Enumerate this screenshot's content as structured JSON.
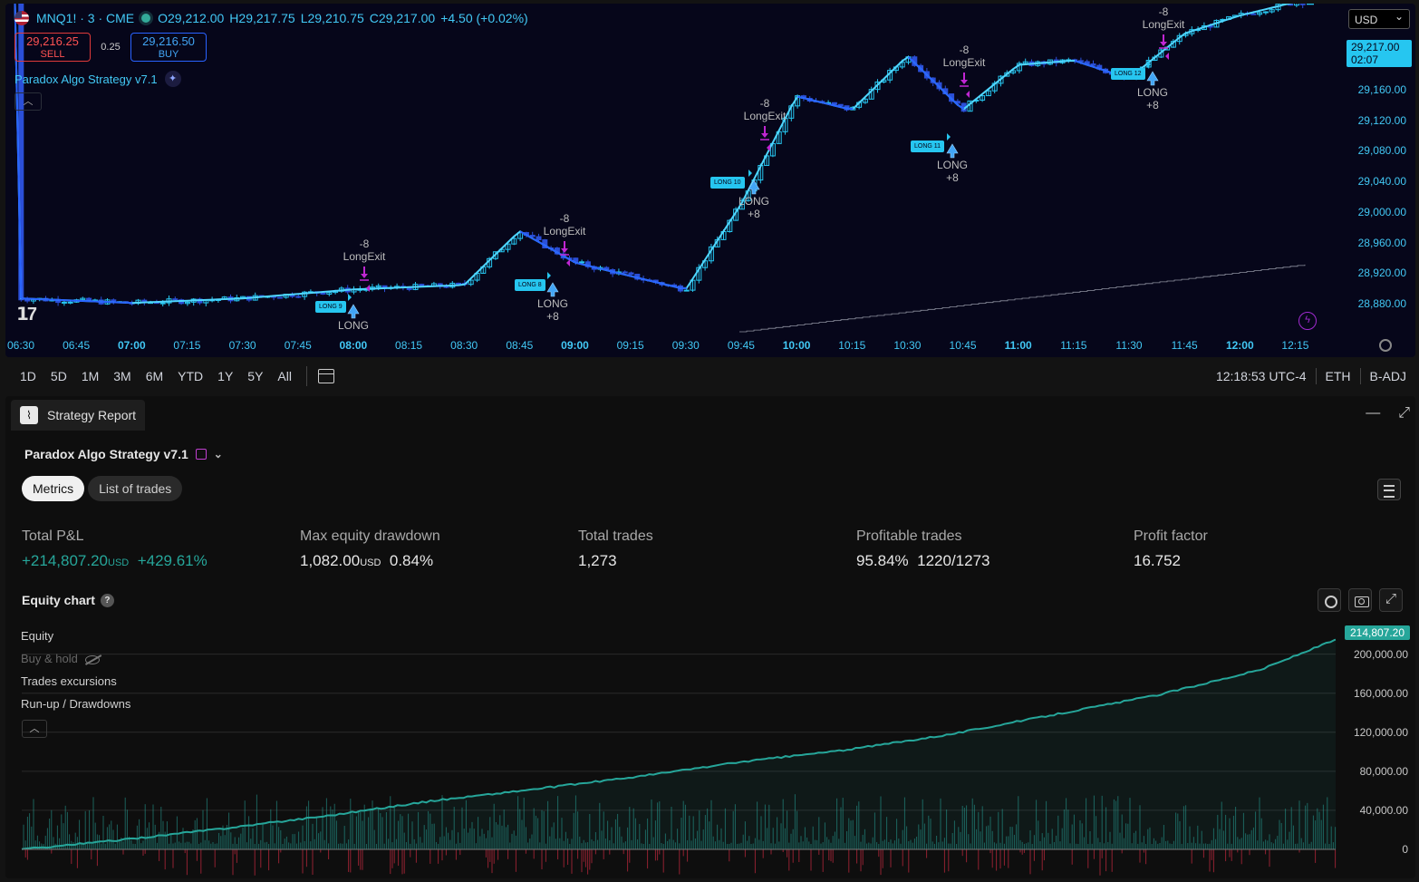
{
  "symbol": {
    "name": "MNQ1! · 3 · CME",
    "open": "O29,212.00",
    "high": "H29,217.75",
    "low": "L29,210.75",
    "close": "C29,217.00",
    "change": "+4.50 (+0.02%)"
  },
  "trade": {
    "sell_price": "29,216.25",
    "sell_label": "SELL",
    "spread": "0.25",
    "buy_price": "29,216.50",
    "buy_label": "BUY"
  },
  "strategy_indicator": "Paradox Algo Strategy v7.1",
  "currency": "USD",
  "last_price": "29,217.00",
  "countdown": "02:07",
  "price_axis": [
    "29,160.00",
    "29,120.00",
    "29,080.00",
    "29,040.00",
    "29,000.00",
    "28,960.00",
    "28,920.00",
    "28,880.00"
  ],
  "time_axis": [
    {
      "t": "06:30",
      "b": false
    },
    {
      "t": "06:45",
      "b": false
    },
    {
      "t": "07:00",
      "b": true
    },
    {
      "t": "07:15",
      "b": false
    },
    {
      "t": "07:30",
      "b": false
    },
    {
      "t": "07:45",
      "b": false
    },
    {
      "t": "08:00",
      "b": true
    },
    {
      "t": "08:15",
      "b": false
    },
    {
      "t": "08:30",
      "b": false
    },
    {
      "t": "08:45",
      "b": false
    },
    {
      "t": "09:00",
      "b": true
    },
    {
      "t": "09:15",
      "b": false
    },
    {
      "t": "09:30",
      "b": false
    },
    {
      "t": "09:45",
      "b": false
    },
    {
      "t": "10:00",
      "b": true
    },
    {
      "t": "10:15",
      "b": false
    },
    {
      "t": "10:30",
      "b": false
    },
    {
      "t": "10:45",
      "b": false
    },
    {
      "t": "11:00",
      "b": true
    },
    {
      "t": "11:15",
      "b": false
    },
    {
      "t": "11:30",
      "b": false
    },
    {
      "t": "11:45",
      "b": false
    },
    {
      "t": "12:00",
      "b": true
    },
    {
      "t": "12:15",
      "b": false
    }
  ],
  "markers": {
    "exit_qty": "-8",
    "exit_label": "LongExit",
    "long_label": "LONG",
    "long_qty": "+8",
    "pill_texts": [
      "LONG 9",
      "LONG 8",
      "LONG 10",
      "LONG 11",
      "LONG 12"
    ]
  },
  "ranges": [
    "1D",
    "5D",
    "1M",
    "3M",
    "6M",
    "YTD",
    "1Y",
    "5Y",
    "All"
  ],
  "status": {
    "clock": "12:18:53 UTC-4",
    "session": "ETH",
    "adj": "B-ADJ"
  },
  "report": {
    "tab_label": "Strategy Report",
    "title": "Paradox Algo Strategy v7.1",
    "tabs": [
      "Metrics",
      "List of trades"
    ],
    "metrics": {
      "pnl_label": "Total P&L",
      "pnl_value": "+214,807.20",
      "pnl_unit": "USD",
      "pnl_pct": "+429.61%",
      "dd_label": "Max equity drawdown",
      "dd_value": "1,082.00",
      "dd_unit": "USD",
      "dd_pct": "0.84%",
      "trades_label": "Total trades",
      "trades_value": "1,273",
      "profitable_label": "Profitable trades",
      "profitable_pct": "95.84%",
      "profitable_ratio": "1220/1273",
      "pf_label": "Profit factor",
      "pf_value": "16.752"
    },
    "equity_title": "Equity chart",
    "equity_legend": [
      "Equity",
      "Buy & hold",
      "Trades excursions",
      "Run-up / Drawdowns"
    ],
    "equity_badge": "214,807.20",
    "equity_axis": [
      "200,000.00",
      "160,000.00",
      "120,000.00",
      "80,000.00",
      "40,000.00",
      "0"
    ]
  },
  "colors": {
    "up_candle": "#26c6f0",
    "down_candle": "#2b4fd8",
    "ma_line": "#4fd6ff",
    "ma_line2": "#2962ff",
    "exit_marker": "#c026d3",
    "equity": "#26a69a",
    "drawdown": "#b2263a"
  },
  "chart_data": [
    {
      "type": "line",
      "title": "",
      "xlabel": "",
      "ylabel": "",
      "x": [
        "06:30",
        "07:00",
        "07:30",
        "08:00",
        "08:30",
        "08:45",
        "09:00",
        "09:30",
        "09:45",
        "10:00",
        "10:15",
        "10:30",
        "10:45",
        "11:00",
        "11:15",
        "11:30",
        "11:45",
        "12:00",
        "12:15"
      ],
      "series": [
        {
          "values": [
            28885,
            28880,
            28885,
            28895,
            28900,
            28960,
            28925,
            28895,
            28990,
            29110,
            29095,
            29155,
            29095,
            29145,
            29150,
            29130,
            29180,
            29200,
            29215
          ]
        }
      ],
      "ylim": [
        28860,
        29185
      ]
    },
    {
      "type": "area",
      "title": "Equity chart",
      "xlabel": "",
      "ylabel": "",
      "x": [
        0,
        100,
        200,
        300,
        400,
        500,
        600,
        700,
        800,
        900,
        1000,
        1100,
        1200,
        1273
      ],
      "series": [
        {
          "name": "Equity",
          "values": [
            0,
            10000,
            22000,
            35000,
            50000,
            62000,
            75000,
            90000,
            102000,
            118000,
            138000,
            158000,
            184000,
            214807.2
          ]
        }
      ],
      "ylim": [
        0,
        214807.2
      ]
    }
  ]
}
